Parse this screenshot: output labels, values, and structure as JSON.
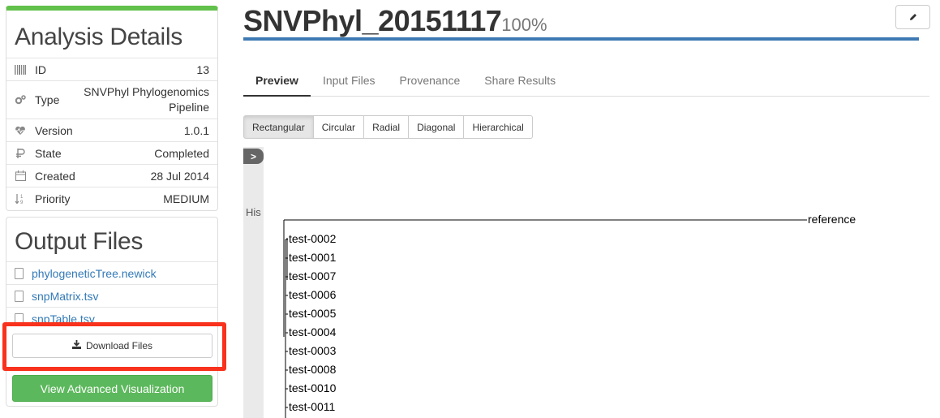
{
  "details": {
    "title": "Analysis Details",
    "rows": [
      {
        "icon": "barcode-icon",
        "label": "ID",
        "value": "13"
      },
      {
        "icon": "gears-icon",
        "label": "Type",
        "value": "SNVPhyl Phylogenomics Pipeline"
      },
      {
        "icon": "heartbeat-icon",
        "label": "Version",
        "value": "1.0.1"
      },
      {
        "icon": "state-icon",
        "label": "State",
        "value": "Completed"
      },
      {
        "icon": "calendar-icon",
        "label": "Created",
        "value": "28 Jul 2014"
      },
      {
        "icon": "sort-numeric-icon",
        "label": "Priority",
        "value": "MEDIUM"
      }
    ]
  },
  "output": {
    "title": "Output Files",
    "files": [
      "phylogeneticTree.newick",
      "snpMatrix.tsv",
      "snpTable.tsv"
    ],
    "download_label": "Download Files",
    "visualize_label": "View Advanced Visualization"
  },
  "header": {
    "title": "SNVPhyl_20151117",
    "percent": "100%"
  },
  "tabs": [
    "Preview",
    "Input Files",
    "Provenance",
    "Share Results"
  ],
  "layouts": [
    "Rectangular",
    "Circular",
    "Radial",
    "Diagonal",
    "Hierarchical"
  ],
  "history": {
    "toggle": ">",
    "label": "His"
  },
  "tree": {
    "leaves": [
      "reference",
      "test-0002",
      "test-0001",
      "test-0007",
      "test-0006",
      "test-0005",
      "test-0004",
      "test-0003",
      "test-0008",
      "test-0010",
      "test-0011"
    ]
  }
}
